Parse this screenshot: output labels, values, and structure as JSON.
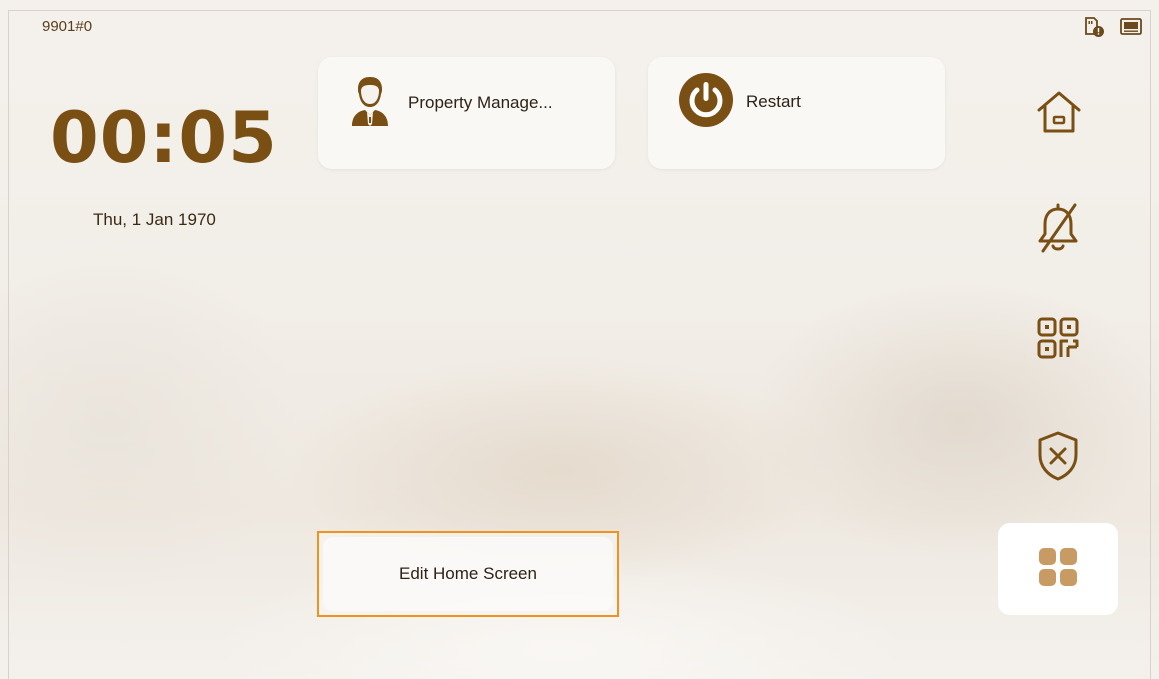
{
  "status_bar": {
    "room_id": "9901#0",
    "icons": [
      "sd-card-alert-icon",
      "monitor-icon"
    ]
  },
  "clock": {
    "time": "00:05",
    "date": "Thu, 1 Jan 1970"
  },
  "shortcuts": [
    {
      "label": "Property Manage...",
      "icon": "property-manager-icon"
    },
    {
      "label": "Restart",
      "icon": "power-icon"
    }
  ],
  "edit_home": {
    "label": "Edit Home Screen"
  },
  "sidebar": {
    "items": [
      {
        "icon": "home-icon"
      },
      {
        "icon": "bell-off-icon"
      },
      {
        "icon": "qr-code-icon"
      },
      {
        "icon": "shield-disarm-icon"
      },
      {
        "icon": "apps-grid-icon"
      }
    ]
  },
  "colors": {
    "accent_brown": "#7a4f14",
    "highlight_orange": "#f0921e",
    "apps_tile_bg": "#ffffff"
  }
}
